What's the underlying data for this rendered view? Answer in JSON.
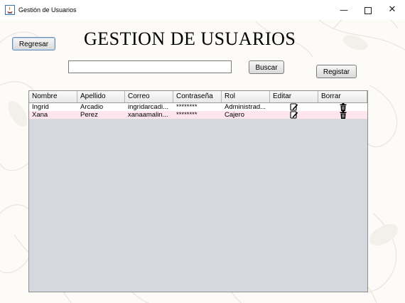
{
  "window": {
    "title": "Gestión de Usuarios",
    "minimize": "—",
    "close": "✕"
  },
  "header": {
    "title": "GESTION DE USUARIOS",
    "back_label": "Regresar"
  },
  "search": {
    "value": "",
    "placeholder": "",
    "button_label": "Buscar"
  },
  "actions": {
    "register_label": "Registar"
  },
  "table": {
    "columns": [
      "Nombre",
      "Apellido",
      "Correo",
      "Contraseña",
      "Rol",
      "Editar",
      "Borrar"
    ],
    "rows": [
      {
        "nombre": "Ingrid",
        "apellido": "Arcadio",
        "correo": "ingridarcadi...",
        "contrasena": "********",
        "rol": "Administrad...",
        "edit_icon": "edit-icon",
        "delete_icon": "trash-icon"
      },
      {
        "nombre": "Xana",
        "apellido": "Perez",
        "correo": "xanaamalin...",
        "contrasena": "********",
        "rol": "Cajero",
        "edit_icon": "edit-icon",
        "delete_icon": "trash-icon"
      }
    ]
  },
  "colors": {
    "row_highlight": "#ffe6ee",
    "table_empty": "#d5d8de",
    "button_focus": "#6b8fb7"
  }
}
